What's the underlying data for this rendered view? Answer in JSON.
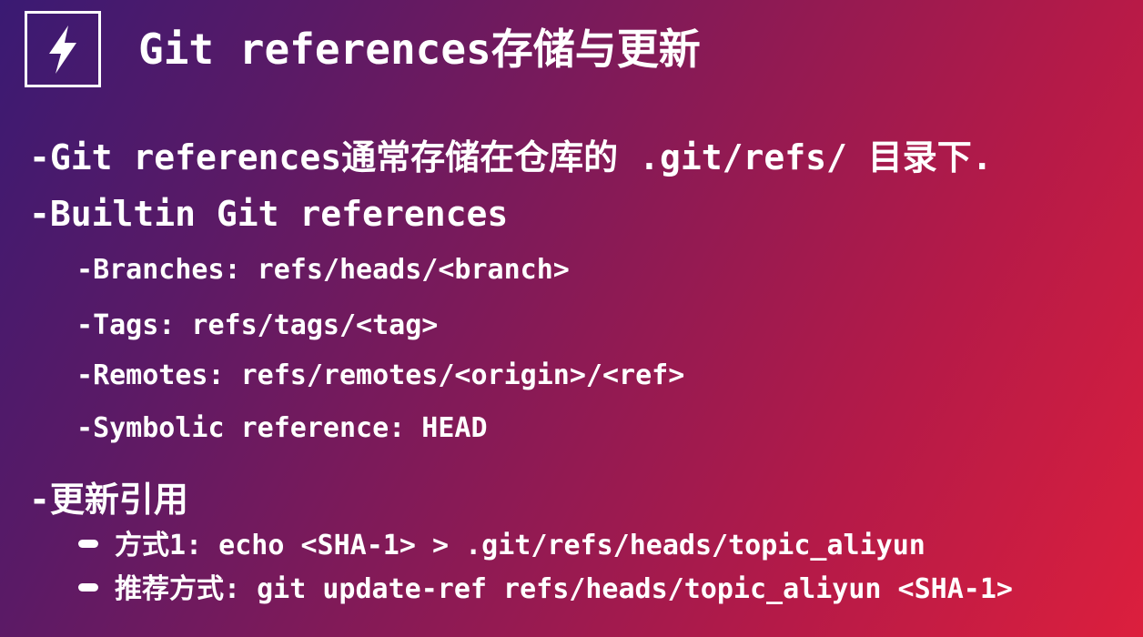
{
  "slide": {
    "title": "Git references存储与更新",
    "icon": "lightning-bolt-icon",
    "bullets": [
      {
        "dash": "- ",
        "text": "Git references通常存储在仓库的 .git/refs/ 目录下."
      },
      {
        "dash": "- ",
        "text": "Builtin Git references"
      }
    ],
    "sub_bullets": [
      {
        "dash": "- ",
        "text": "Branches: refs/heads/<branch>"
      },
      {
        "dash": "- ",
        "text": "Tags: refs/tags/<tag>"
      },
      {
        "dash": "- ",
        "text": "Remotes: refs/remotes/<origin>/<ref>"
      },
      {
        "dash": "- ",
        "text": "Symbolic reference: HEAD"
      }
    ],
    "update_section": {
      "dash": "- ",
      "text": "更新引用"
    },
    "update_items": [
      {
        "text": "方式1: echo <SHA-1> > .git/refs/heads/topic_aliyun"
      },
      {
        "text": "推荐方式: git update-ref refs/heads/topic_aliyun <SHA-1>"
      }
    ]
  }
}
